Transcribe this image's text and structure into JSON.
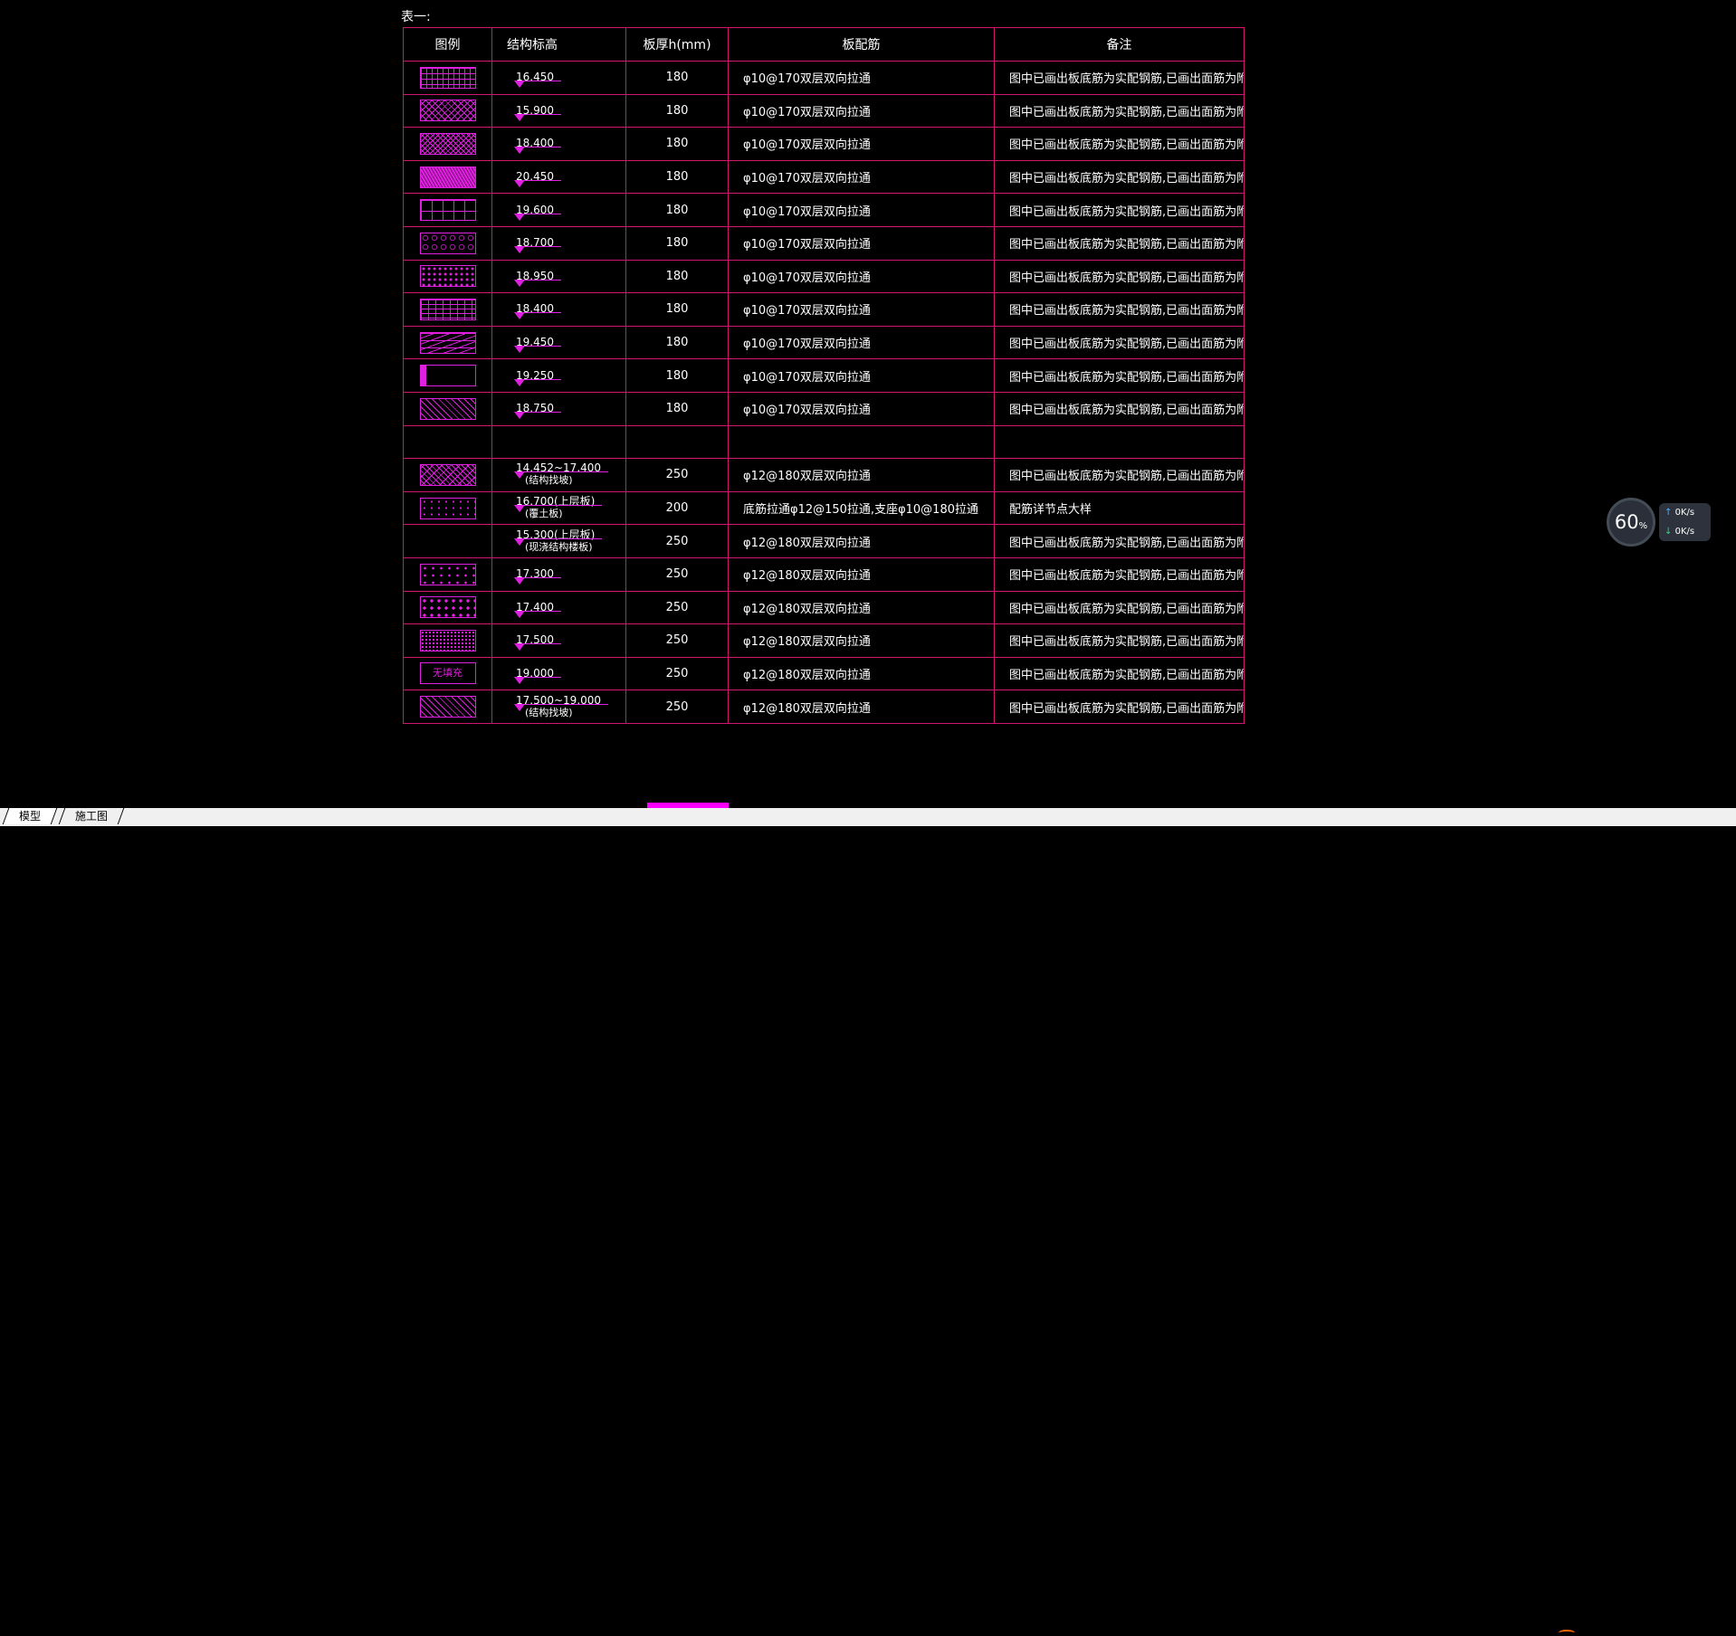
{
  "caption": "表一:",
  "headers": [
    "图例",
    "结构标高",
    "板厚h(mm)",
    "板配筋",
    "备注"
  ],
  "rows": [
    {
      "pattern": "grid",
      "elevation": "16.450",
      "sub": "",
      "thickness": "180",
      "rebar": "φ10@170双层双向拉通",
      "note": "图中已画出板底筋为实配钢筋,已画出面筋为附加面筋。"
    },
    {
      "pattern": "herring",
      "elevation": "15.900",
      "sub": "",
      "thickness": "180",
      "rebar": "φ10@170双层双向拉通",
      "note": "图中已画出板底筋为实配钢筋,已画出面筋为附加面筋。"
    },
    {
      "pattern": "cross",
      "elevation": "18.400",
      "sub": "",
      "thickness": "180",
      "rebar": "φ10@170双层双向拉通",
      "note": "图中已画出板底筋为实配钢筋,已画出面筋为附加面筋。"
    },
    {
      "pattern": "solid",
      "elevation": "20.450",
      "sub": "",
      "thickness": "180",
      "rebar": "φ10@170双层双向拉通",
      "note": "图中已画出板底筋为实配钢筋,已画出面筋为附加面筋。"
    },
    {
      "pattern": "key",
      "elevation": "19.600",
      "sub": "",
      "thickness": "180",
      "rebar": "φ10@170双层双向拉通",
      "note": "图中已画出板底筋为实配钢筋,已画出面筋为附加面筋。"
    },
    {
      "pattern": "circ",
      "elevation": "18.700",
      "sub": "",
      "thickness": "180",
      "rebar": "φ10@170双层双向拉通",
      "note": "图中已画出板底筋为实配钢筋,已画出面筋为附加面筋。"
    },
    {
      "pattern": "dots",
      "elevation": "18.950",
      "sub": "",
      "thickness": "180",
      "rebar": "φ10@170双层双向拉通",
      "note": "图中已画出板底筋为实配钢筋,已画出面筋为附加面筋。"
    },
    {
      "pattern": "brick",
      "elevation": "18.400",
      "sub": "",
      "thickness": "180",
      "rebar": "φ10@170双层双向拉通",
      "note": "图中已画出板底筋为实配钢筋,已画出面筋为附加面筋。"
    },
    {
      "pattern": "wave",
      "elevation": "19.450",
      "sub": "",
      "thickness": "180",
      "rebar": "φ10@170双层双向拉通",
      "note": "图中已画出板底筋为实配钢筋,已画出面筋为附加面筋。"
    },
    {
      "pattern": "dash",
      "elevation": "19.250",
      "sub": "",
      "thickness": "180",
      "rebar": "φ10@170双层双向拉通",
      "note": "图中已画出板底筋为实配钢筋,已画出面筋为附加面筋。"
    },
    {
      "pattern": "diag",
      "elevation": "18.750",
      "sub": "",
      "thickness": "180",
      "rebar": "φ10@170双层双向拉通",
      "note": "图中已画出板底筋为实配钢筋,已画出面筋为附加面筋。"
    },
    {
      "pattern": "none",
      "elevation": "",
      "sub": "",
      "thickness": "",
      "rebar": "",
      "note": ""
    },
    {
      "pattern": "diag2",
      "elevation": "14.452~17.400",
      "sub": "(结构找坡)",
      "thickness": "250",
      "rebar": "φ12@180双层双向拉通",
      "note": "图中已画出板底筋为实配钢筋,已画出面筋为附加面筋。"
    },
    {
      "pattern": "sparse",
      "elevation": "16.700(上层板)",
      "sub": "(覆土板)",
      "thickness": "200",
      "rebar": "底筋拉通φ12@150拉通,支座φ10@180拉通",
      "note": "配筋详节点大样"
    },
    {
      "pattern": "sparse-cont",
      "elevation": "15.300(上层板)",
      "sub": "(现浇结构楼板)",
      "thickness": "250",
      "rebar": "φ12@180双层双向拉通",
      "note": "图中已画出板底筋为实配钢筋,已画出面筋为附加面筋。"
    },
    {
      "pattern": "xs",
      "elevation": "17.300",
      "sub": "",
      "thickness": "250",
      "rebar": "φ12@180双层双向拉通",
      "note": "图中已画出板底筋为实配钢筋,已画出面筋为附加面筋。"
    },
    {
      "pattern": "tri",
      "elevation": "17.400",
      "sub": "",
      "thickness": "250",
      "rebar": "φ12@180双层双向拉通",
      "note": "图中已画出板底筋为实配钢筋,已画出面筋为附加面筋。"
    },
    {
      "pattern": "fine",
      "elevation": "17.500",
      "sub": "",
      "thickness": "250",
      "rebar": "φ12@180双层双向拉通",
      "note": "图中已画出板底筋为实配钢筋,已画出面筋为附加面筋。"
    },
    {
      "pattern": "text",
      "pattern_text": "无填充",
      "elevation": "19.000",
      "sub": "",
      "thickness": "250",
      "rebar": "φ12@180双层双向拉通",
      "note": "图中已画出板底筋为实配钢筋,已画出面筋为附加面筋。"
    },
    {
      "pattern": "diag",
      "elevation": "17.500~19.000",
      "sub": "(结构找坡)",
      "thickness": "250",
      "rebar": "φ12@180双层双向拉通",
      "note": "图中已画出板底筋为实配钢筋,已画出面筋为附加面筋。"
    }
  ],
  "tabs": [
    {
      "label": "模型",
      "active": true
    },
    {
      "label": "施工图",
      "active": false
    }
  ],
  "widget": {
    "percent": "60",
    "percent_unit": "%",
    "up_speed": "0",
    "up_unit": "K/s",
    "down_speed": "0",
    "down_unit": "K/s"
  },
  "colors": {
    "table_border": "#d01670",
    "pattern": "#e020e0",
    "background": "#000000",
    "accent": "#ff00ff"
  }
}
